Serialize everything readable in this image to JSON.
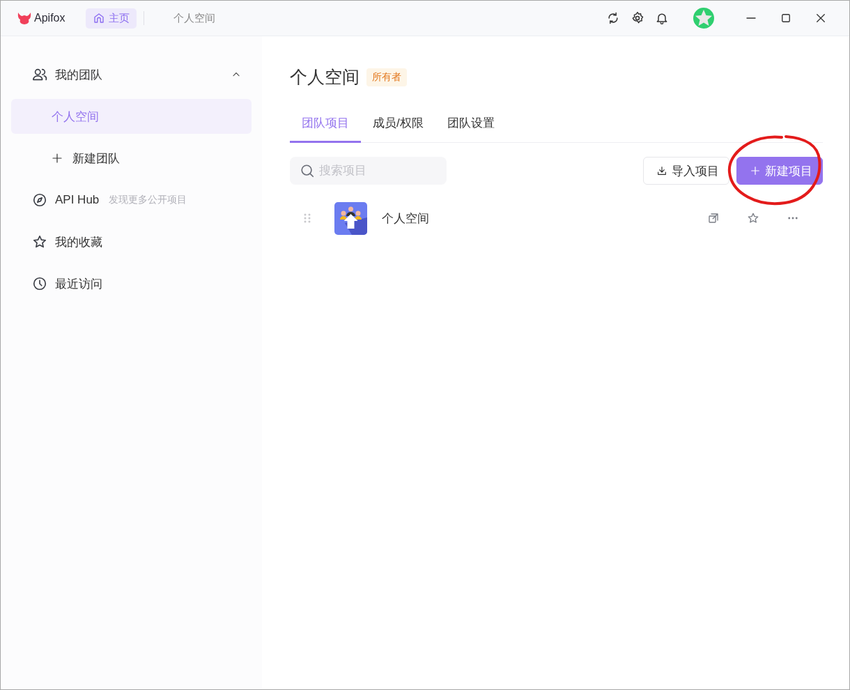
{
  "titlebar": {
    "app_name": "Apifox",
    "tabs": [
      {
        "label": "主页",
        "selected": true
      },
      {
        "label": "个人空间",
        "selected": false
      }
    ]
  },
  "sidebar": {
    "items": [
      {
        "kind": "group",
        "label": "我的团队",
        "expanded": true,
        "selected": false,
        "children": [
          {
            "kind": "link",
            "label": "个人空间",
            "selected": true
          },
          {
            "kind": "add",
            "label": "新建团队",
            "selected": false
          }
        ]
      },
      {
        "kind": "link",
        "label": "API Hub",
        "hint": "发现更多公开项目",
        "selected": false
      },
      {
        "kind": "link",
        "label": "我的收藏",
        "selected": false
      },
      {
        "kind": "link",
        "label": "最近访问",
        "selected": false
      }
    ]
  },
  "main": {
    "title": "个人空间",
    "role_badge": "所有者",
    "tabs": [
      {
        "label": "团队项目",
        "selected": true
      },
      {
        "label": "成员/权限",
        "selected": false
      },
      {
        "label": "团队设置",
        "selected": false
      }
    ],
    "search": {
      "placeholder": "搜索项目"
    },
    "buttons": [
      {
        "kind": "secondary",
        "label": "导入项目"
      },
      {
        "kind": "primary",
        "label": "新建项目"
      }
    ],
    "projects": [
      {
        "name": "个人空间"
      }
    ]
  }
}
